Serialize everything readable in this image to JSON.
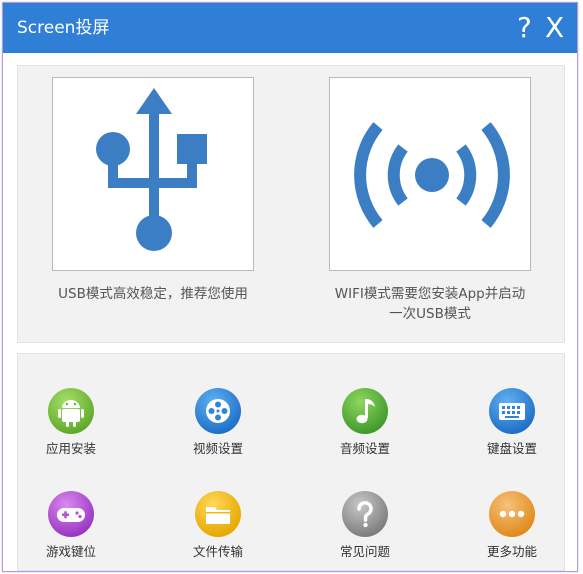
{
  "window": {
    "title": "Screen投屏",
    "help_label": "?",
    "close_label": "X",
    "titlebar_color": "#2f7fd6"
  },
  "modes": {
    "usb": {
      "icon": "usb-icon",
      "description": "USB模式高效稳定，推荐您使用"
    },
    "wifi": {
      "icon": "wifi-signal-icon",
      "description_line1": "WIFI模式需要您安装App并启动",
      "description_line2": "一次USB模式"
    },
    "icon_color": "#3c7ec4"
  },
  "features": [
    {
      "label": "应用安装",
      "icon": "android-icon",
      "color": "#7cc23a"
    },
    {
      "label": "视频设置",
      "icon": "film-reel-icon",
      "color": "#2f86d8"
    },
    {
      "label": "音频设置",
      "icon": "music-note-icon",
      "color": "#5ab03c"
    },
    {
      "label": "键盘设置",
      "icon": "keyboard-icon",
      "color": "#2f86d8"
    },
    {
      "label": "游戏键位",
      "icon": "gamepad-icon",
      "color": "#b552d6"
    },
    {
      "label": "文件传输",
      "icon": "folder-icon",
      "color": "#f2b80e"
    },
    {
      "label": "常见问题",
      "icon": "question-icon",
      "color": "#9a9a9a"
    },
    {
      "label": "更多功能",
      "icon": "more-dots-icon",
      "color": "#f0a23c"
    }
  ]
}
